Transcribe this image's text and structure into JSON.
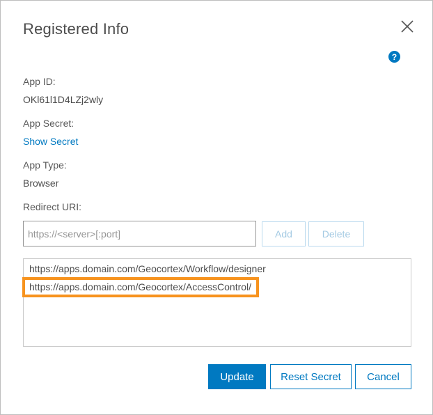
{
  "dialog": {
    "title": "Registered Info",
    "help_label": "?"
  },
  "fields": {
    "app_id_label": "App ID:",
    "app_id_value": "OKl61l1D4LZj2wly",
    "app_secret_label": "App Secret:",
    "show_secret_link": "Show Secret",
    "app_type_label": "App Type:",
    "app_type_value": "Browser",
    "redirect_uri_label": "Redirect URI:"
  },
  "redirect": {
    "input_value": "",
    "input_placeholder": "https://<server>[:port]",
    "add_label": "Add",
    "delete_label": "Delete",
    "uris": [
      "https://apps.domain.com/Geocortex/Workflow/designer",
      "https://apps.domain.com/Geocortex/AccessControl/"
    ],
    "highlight_color": "#f7931e"
  },
  "footer": {
    "update_label": "Update",
    "reset_secret_label": "Reset Secret",
    "cancel_label": "Cancel"
  },
  "colors": {
    "accent": "#0079c1",
    "highlight": "#f7931e"
  }
}
